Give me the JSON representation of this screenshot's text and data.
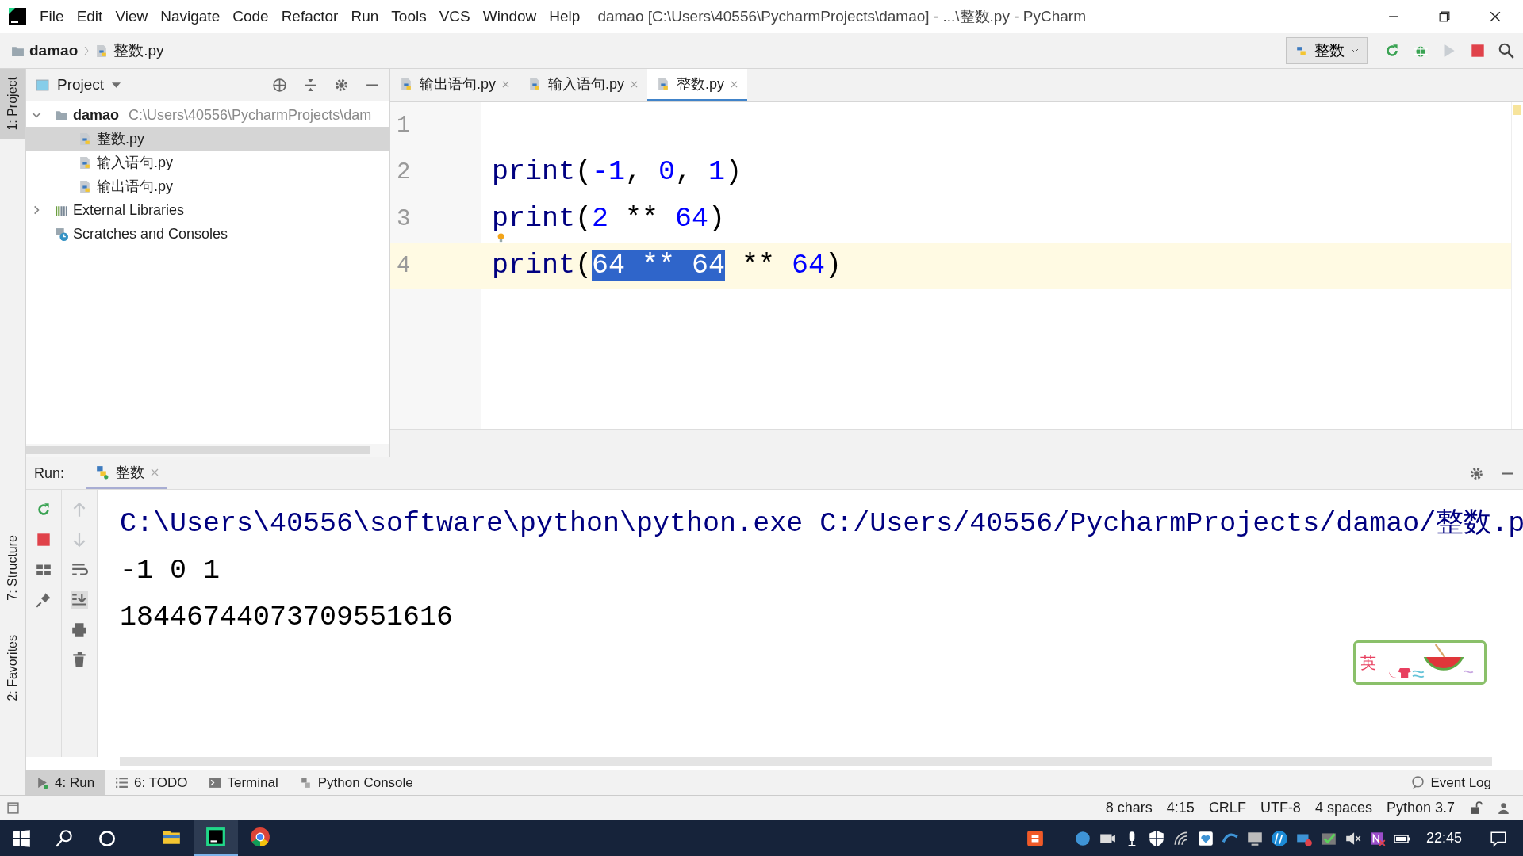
{
  "menu_bar": {
    "items": [
      "File",
      "Edit",
      "View",
      "Navigate",
      "Code",
      "Refactor",
      "Run",
      "Tools",
      "VCS",
      "Window",
      "Help"
    ],
    "title": "damao [C:\\Users\\40556\\PycharmProjects\\damao] - ...\\整数.py - PyCharm"
  },
  "navigation_bar": {
    "breadcrumbs": [
      "damao",
      "整数.py"
    ],
    "run_config": "整数"
  },
  "tool_stripe": [
    {
      "label": "1: Project",
      "selected": true
    },
    {
      "label": "7: Structure",
      "selected": false
    },
    {
      "label": "2: Favorites",
      "selected": false
    }
  ],
  "project_panel": {
    "title": "Project",
    "tree": [
      {
        "label": "damao",
        "path": "C:\\Users\\40556\\PycharmProjects\\dam",
        "kind": "folder",
        "expanded": true,
        "selected": false,
        "children": [
          {
            "label": "整数.py",
            "kind": "python",
            "selected": true
          },
          {
            "label": "输入语句.py",
            "kind": "python",
            "selected": false
          },
          {
            "label": "输出语句.py",
            "kind": "python",
            "selected": false
          }
        ]
      },
      {
        "label": "External Libraries",
        "kind": "libraries",
        "expanded": false,
        "selected": false
      },
      {
        "label": "Scratches and Consoles",
        "kind": "scratches",
        "selected": false
      }
    ]
  },
  "editor": {
    "tabs": [
      {
        "label": "输出语句.py",
        "selected": false
      },
      {
        "label": "输入语句.py",
        "selected": false
      },
      {
        "label": "整数.py",
        "selected": true
      }
    ],
    "lines": [
      {
        "number": "1",
        "current": false,
        "bulb": false
      },
      {
        "number": "2",
        "current": false,
        "bulb": false,
        "tokens": [
          {
            "text": "print",
            "kind": "builtin",
            "selected": false
          },
          {
            "text": "(",
            "kind": "punct",
            "selected": false
          },
          {
            "text": "-1",
            "kind": "number",
            "selected": false
          },
          {
            "text": ", ",
            "kind": "punct",
            "selected": false
          },
          {
            "text": "0",
            "kind": "number",
            "selected": false
          },
          {
            "text": ", ",
            "kind": "punct",
            "selected": false
          },
          {
            "text": "1",
            "kind": "number",
            "selected": false
          },
          {
            "text": ")",
            "kind": "punct",
            "selected": false
          }
        ]
      },
      {
        "number": "3",
        "current": false,
        "bulb": true,
        "tokens": [
          {
            "text": "print",
            "kind": "builtin",
            "selected": false
          },
          {
            "text": "(",
            "kind": "punct",
            "selected": false
          },
          {
            "text": "2",
            "kind": "number",
            "selected": false
          },
          {
            "text": " ** ",
            "kind": "punct",
            "selected": false
          },
          {
            "text": "64",
            "kind": "number",
            "selected": false
          },
          {
            "text": ")",
            "kind": "punct",
            "selected": false
          }
        ]
      },
      {
        "number": "4",
        "current": true,
        "bulb": false,
        "tokens": [
          {
            "text": "print",
            "kind": "builtin",
            "selected": false
          },
          {
            "text": "(",
            "kind": "punct",
            "selected": false
          },
          {
            "text": "64 ** 64",
            "kind": "number",
            "selected": true
          },
          {
            "text": " ** ",
            "kind": "punct",
            "selected": false
          },
          {
            "text": "64",
            "kind": "number",
            "selected": false
          },
          {
            "text": ")",
            "kind": "punct",
            "selected": false
          }
        ]
      }
    ]
  },
  "run_panel": {
    "label": "Run:",
    "tab": "整数",
    "console": [
      {
        "text": "C:\\Users\\40556\\software\\python\\python.exe C:/Users/40556/PycharmProjects/damao/整数.p",
        "kind": "command"
      },
      {
        "text": "-1 0 1",
        "kind": "output"
      },
      {
        "text": "18446744073709551616",
        "kind": "output"
      }
    ]
  },
  "ime_widget": {
    "label": "英"
  },
  "bottom_tools": [
    {
      "label": "4: Run",
      "selected": true
    },
    {
      "label": "6: TODO",
      "selected": false
    },
    {
      "label": "Terminal",
      "selected": false
    },
    {
      "label": "Python Console",
      "selected": false
    }
  ],
  "event_log": "Event Log",
  "status_bar": [
    "8 chars",
    "4:15",
    "CRLF",
    "UTF-8",
    "4 spaces",
    "Python 3.7"
  ],
  "taskbar": {
    "time": "22:45",
    "apps": [
      {
        "kind": "explorer",
        "selected": false
      },
      {
        "kind": "pycharm",
        "selected": true
      },
      {
        "kind": "chrome",
        "selected": false
      }
    ]
  }
}
